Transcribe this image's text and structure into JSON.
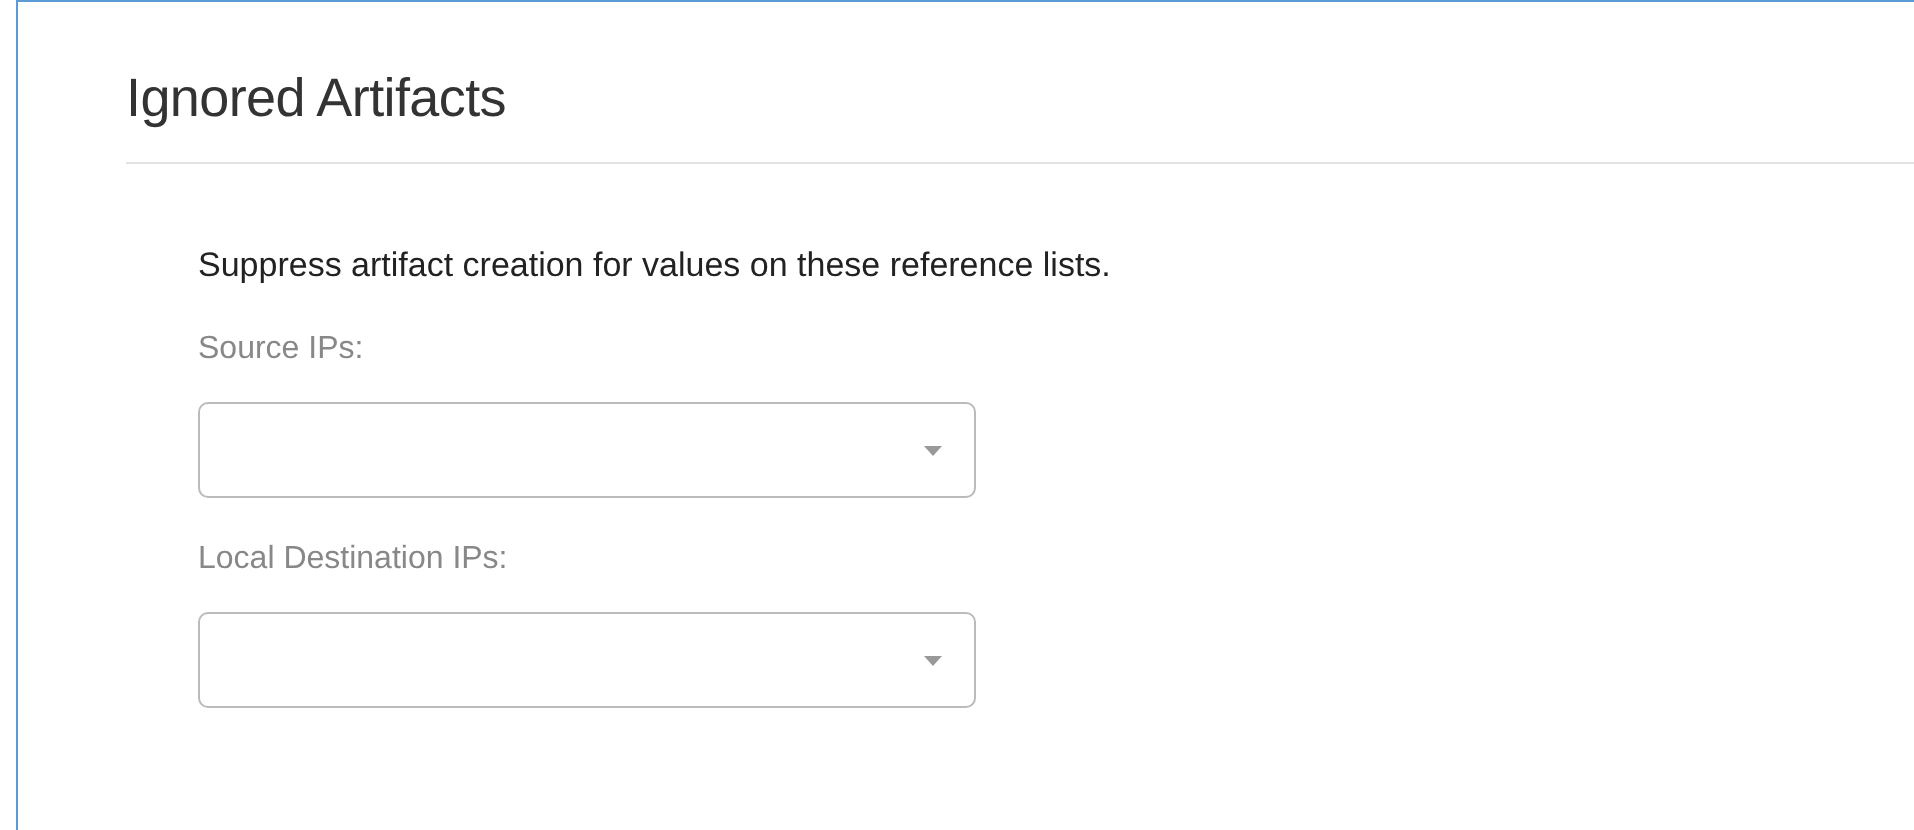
{
  "section": {
    "title": "Ignored Artifacts"
  },
  "description": "Suppress artifact creation for values on these reference lists.",
  "fields": [
    {
      "label": "Source IPs:"
    },
    {
      "label": "Local Destination IPs:"
    }
  ]
}
